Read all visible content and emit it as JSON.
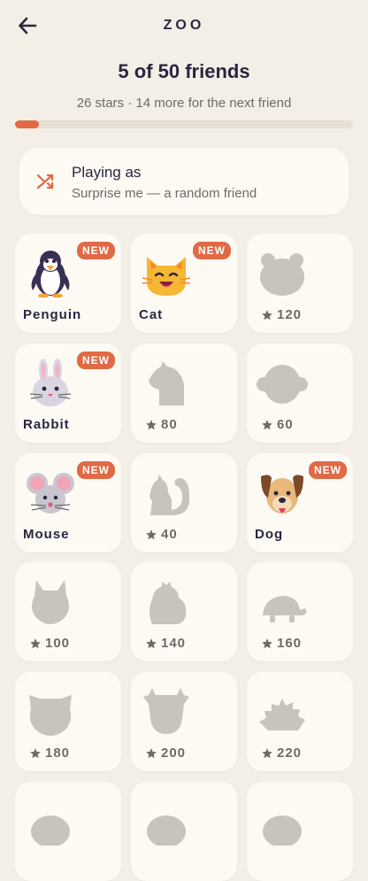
{
  "header": {
    "title": "ZOO",
    "back_icon": "arrow-left-icon"
  },
  "progress": {
    "headline": "5 of 50 friends",
    "subline": "26 stars · 14 more for the next friend",
    "fraction": 0.07,
    "color": "#e06a43"
  },
  "playing_as": {
    "icon": "shuffle-icon",
    "title": "Playing as",
    "subtitle": "Surprise me — a random friend"
  },
  "accent": "#df6a45",
  "tiles": [
    {
      "type": "unlocked",
      "icon": "penguin-icon",
      "label": "Penguin",
      "badge": "NEW"
    },
    {
      "type": "unlocked",
      "icon": "cat-icon",
      "label": "Cat",
      "badge": "NEW"
    },
    {
      "type": "locked",
      "icon": "bear-silhouette-icon",
      "cost": "120"
    },
    {
      "type": "unlocked",
      "icon": "rabbit-icon",
      "label": "Rabbit",
      "badge": "NEW"
    },
    {
      "type": "locked",
      "icon": "horse-silhouette-icon",
      "cost": "80"
    },
    {
      "type": "locked",
      "icon": "monkey-silhouette-icon",
      "cost": "60"
    },
    {
      "type": "unlocked",
      "icon": "mouse-icon",
      "label": "Mouse",
      "badge": "NEW"
    },
    {
      "type": "locked",
      "icon": "squirrel-silhouette-icon",
      "cost": "40"
    },
    {
      "type": "unlocked",
      "icon": "dog-icon",
      "label": "Dog",
      "badge": "NEW"
    },
    {
      "type": "locked",
      "icon": "fox-silhouette-icon",
      "cost": "100"
    },
    {
      "type": "locked",
      "icon": "chicken-silhouette-icon",
      "cost": "140"
    },
    {
      "type": "locked",
      "icon": "turtle-silhouette-icon",
      "cost": "160"
    },
    {
      "type": "locked",
      "icon": "pig-silhouette-icon",
      "cost": "180"
    },
    {
      "type": "locked",
      "icon": "cow-silhouette-icon",
      "cost": "200"
    },
    {
      "type": "locked",
      "icon": "hedgehog-silhouette-icon",
      "cost": "220"
    },
    {
      "type": "locked",
      "icon": "locked-silhouette-icon",
      "cost": ""
    },
    {
      "type": "locked",
      "icon": "locked-silhouette-icon",
      "cost": ""
    },
    {
      "type": "locked",
      "icon": "locked-silhouette-icon",
      "cost": ""
    }
  ]
}
